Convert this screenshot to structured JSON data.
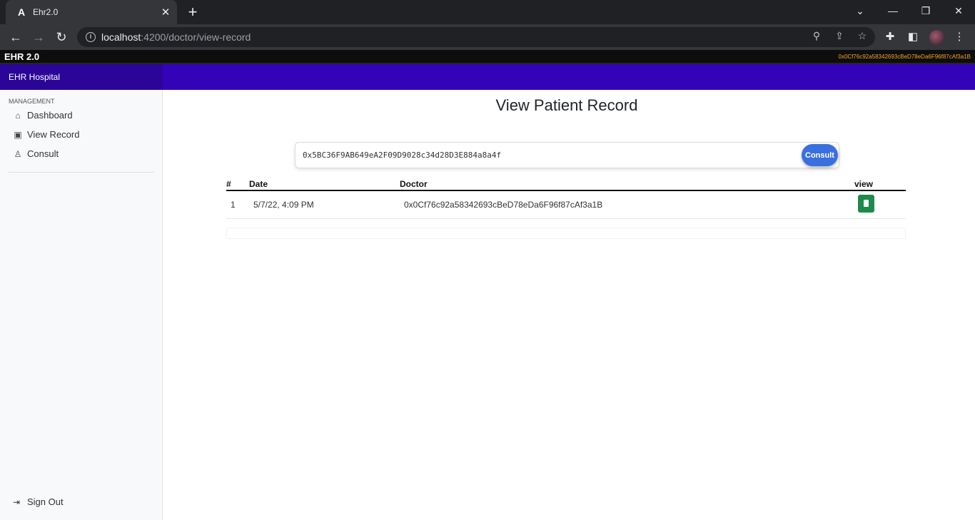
{
  "browser": {
    "tab_title": "Ehr2.0",
    "favicon": "A",
    "url_host": "localhost",
    "url_path": ":4200/doctor/view-record"
  },
  "app": {
    "brand": "EHR 2.0",
    "account_address": "0x0Cf76c92a58342693cBeD78eDa6F96f87cAf3a1B",
    "hospital": "EHR Hospital"
  },
  "sidebar": {
    "section": "MANAGEMENT",
    "items": [
      {
        "label": "Dashboard",
        "icon": "home-icon"
      },
      {
        "label": "View Record",
        "icon": "file-icon"
      },
      {
        "label": "Consult",
        "icon": "doctor-icon"
      }
    ],
    "signout": "Sign Out"
  },
  "main": {
    "title": "View Patient Record",
    "search_value": "0x5BC36F9AB649eA2F09D9028c34d28D3E884a8a4f",
    "consult_label": "Consult",
    "table": {
      "headers": [
        "#",
        "Date",
        "Doctor",
        "view"
      ],
      "rows": [
        {
          "index": "1",
          "date": "5/7/22, 4:09 PM",
          "doctor": "0x0Cf76c92a58342693cBeD78eDa6F96f87cAf3a1B"
        }
      ]
    }
  },
  "colors": {
    "header": "#3303b8",
    "hospital_block": "#2b0598",
    "consult_button": "#3a6fe0",
    "view_button": "#1e8a4c",
    "account_text": "#f5a623"
  }
}
